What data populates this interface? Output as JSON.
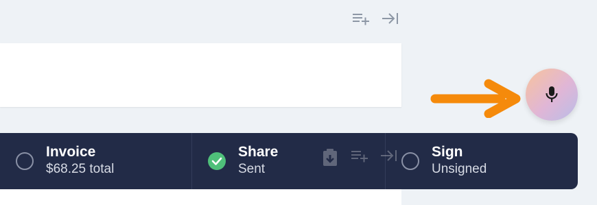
{
  "toolbar": {
    "icons": [
      "add-to-list-icon",
      "collapse-panel-icon"
    ]
  },
  "assistant": {
    "icon": "microphone-icon",
    "arrow_color": "#f58a0b",
    "gradient_colors": [
      "#f8c39c",
      "#e0b6d6",
      "#b9bde8"
    ]
  },
  "steps": [
    {
      "title": "Invoice",
      "subtitle": "$68.25 total",
      "status": "incomplete"
    },
    {
      "title": "Share",
      "subtitle": "Sent",
      "status": "complete"
    },
    {
      "title": "Sign",
      "subtitle": "Unsigned",
      "status": "incomplete"
    }
  ],
  "colors": {
    "bar_background": "#222b47",
    "complete": "#4fc07a",
    "page_background": "#eef2f6"
  }
}
